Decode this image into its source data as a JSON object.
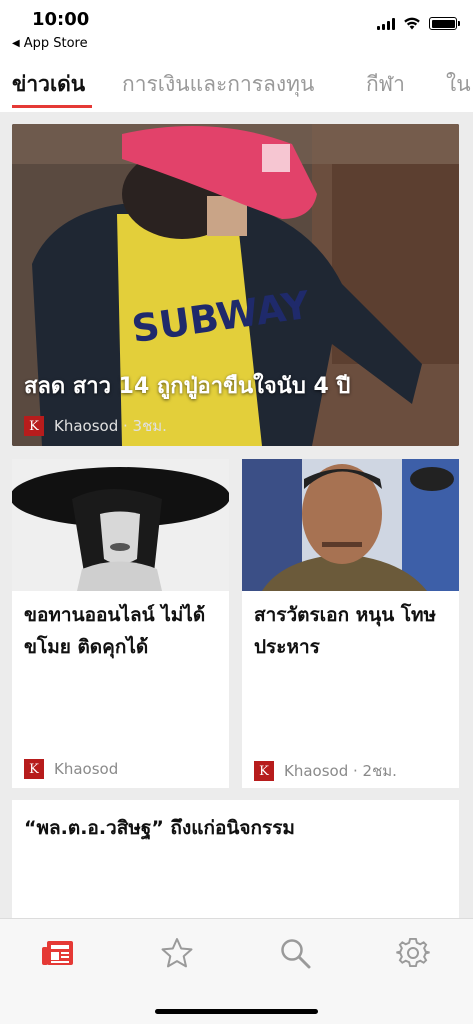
{
  "status_bar": {
    "time": "10:00",
    "back_label": "App Store"
  },
  "tabs": [
    {
      "label": "ข่าวเด่น",
      "active": true
    },
    {
      "label": "การเงินและการลงทุน",
      "active": false
    },
    {
      "label": "กีฬา",
      "active": false
    },
    {
      "label": "ใน",
      "active": false
    }
  ],
  "hero": {
    "title": "สลด สาว 14 ถูกปู่อาขืนใจนับ 4 ปี",
    "source_logo": "K",
    "source": "Khaosod · 3ชม."
  },
  "cards": [
    {
      "title": "ขอทานออนไลน์ ไม่ได้ ขโมย ติดคุกได้",
      "source_logo": "K",
      "source": "Khaosod"
    },
    {
      "title": "สารวัตรเอก หนุน โทษประหาร",
      "source_logo": "K",
      "source": "Khaosod · 2ชม."
    }
  ],
  "wide_card": {
    "title": "“พล.ต.อ.วสิษฐ” ถึงแก่อนิจกรรม"
  },
  "tabbar": {
    "items": [
      {
        "icon": "news-icon",
        "active": true
      },
      {
        "icon": "star-icon",
        "active": false
      },
      {
        "icon": "search-icon",
        "active": false
      },
      {
        "icon": "gear-icon",
        "active": false
      }
    ]
  },
  "colors": {
    "accent": "#e53935",
    "logo_bg": "#b71c1c",
    "inactive_icon": "#9a9a9a"
  }
}
